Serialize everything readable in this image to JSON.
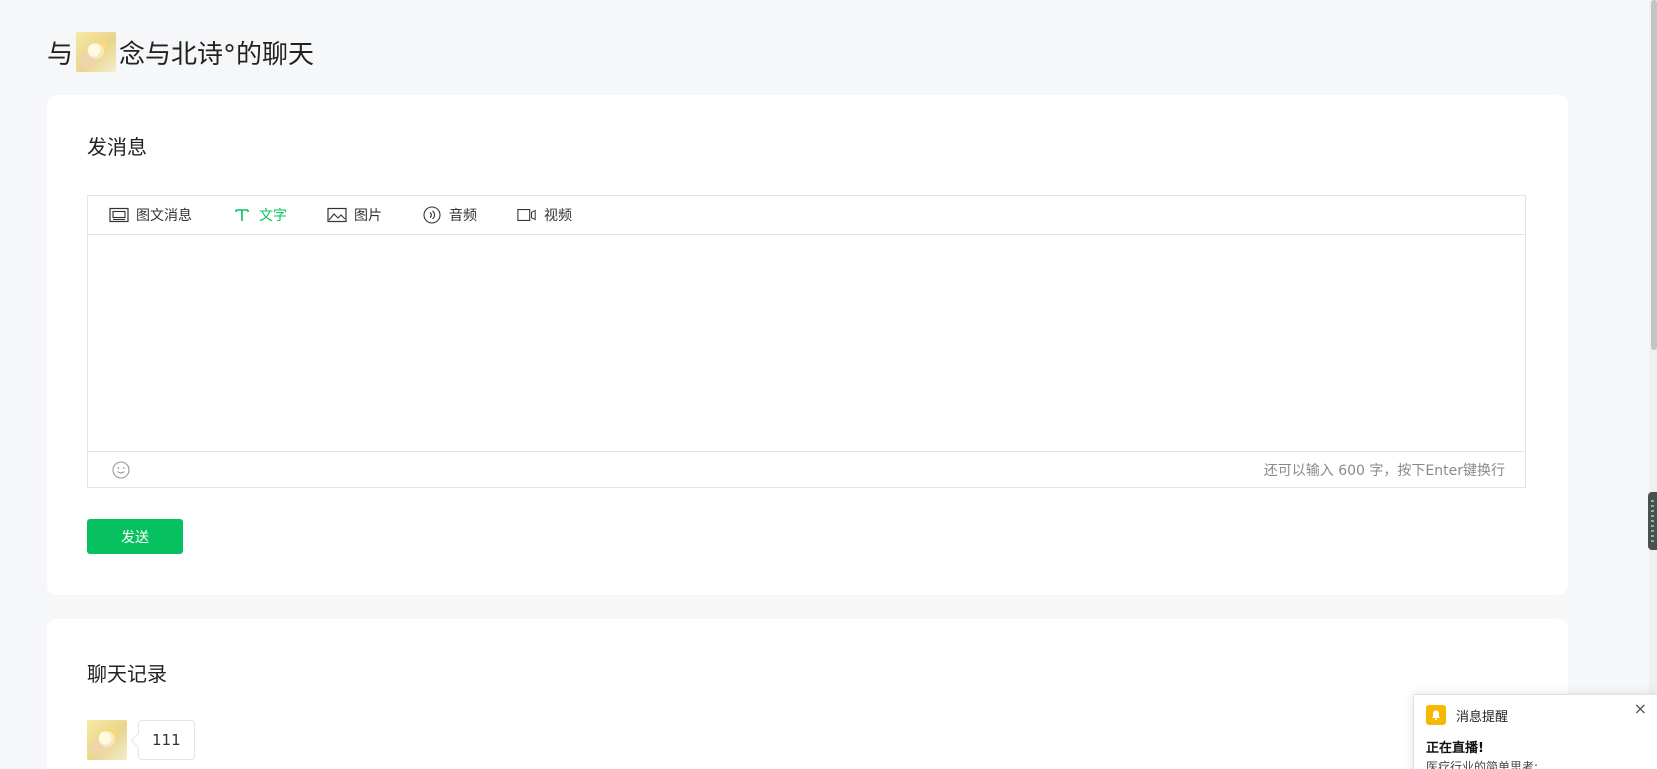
{
  "page": {
    "title_prefix": "与",
    "title_name": "念与北诗°的聊天"
  },
  "send_section": {
    "title": "发消息",
    "tabs": [
      {
        "label": "图文消息",
        "icon": "article-icon",
        "active": false
      },
      {
        "label": "文字",
        "icon": "text-icon",
        "active": true
      },
      {
        "label": "图片",
        "icon": "image-icon",
        "active": false
      },
      {
        "label": "音频",
        "icon": "audio-icon",
        "active": false
      },
      {
        "label": "视频",
        "icon": "video-icon",
        "active": false
      }
    ],
    "editor_value": "",
    "counter_text": "还可以输入 600 字，按下Enter键换行",
    "send_label": "发送"
  },
  "history_section": {
    "title": "聊天记录",
    "messages": [
      {
        "text": "111"
      }
    ]
  },
  "notification": {
    "title": "消息提醒",
    "close": "×",
    "headline": "正在直播!",
    "body": "医疗行业的简单思考:"
  },
  "colors": {
    "accent": "#07c160",
    "background": "#f6f7f9",
    "bell": "#f6b800"
  }
}
